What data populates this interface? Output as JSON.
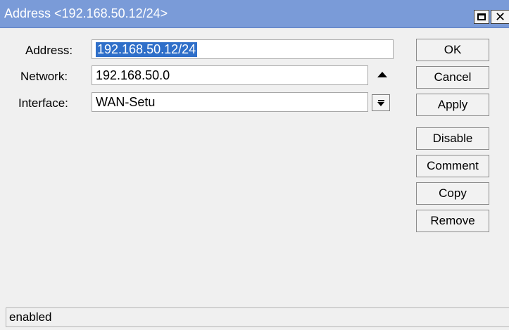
{
  "window": {
    "title": "Address <192.168.50.12/24>"
  },
  "form": {
    "address": {
      "label": "Address:",
      "value": "192.168.50.12/24",
      "selected": true
    },
    "network": {
      "label": "Network:",
      "value": "192.168.50.0"
    },
    "interface": {
      "label": "Interface:",
      "value": "WAN-Setu"
    }
  },
  "buttons": {
    "ok": "OK",
    "cancel": "Cancel",
    "apply": "Apply",
    "disable": "Disable",
    "comment": "Comment",
    "copy": "Copy",
    "remove": "Remove"
  },
  "status": {
    "text": "enabled"
  },
  "icons": {
    "maximize": "maximize-icon",
    "close": "close-icon",
    "collapse": "collapse-up-icon",
    "dropdown": "dropdown-arrow-icon"
  },
  "colors": {
    "titlebar": "#7a9bd8",
    "selection": "#2f6fc9",
    "background": "#f0f0f0"
  }
}
